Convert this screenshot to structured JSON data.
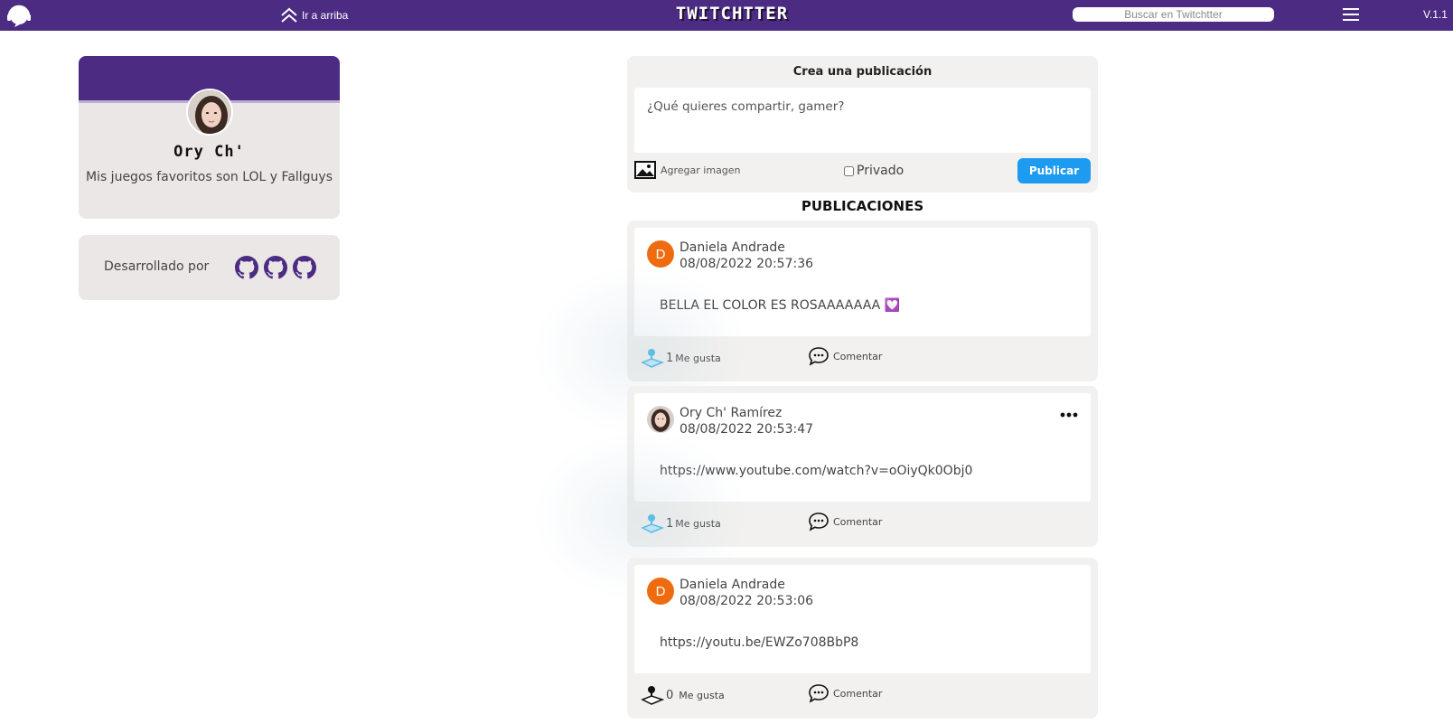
{
  "navbar": {
    "top_link_label": "Ir a arriba",
    "brand": "TWITCHTTER",
    "search_placeholder": "Buscar en Twitchtter",
    "version": "V.1.1"
  },
  "profile": {
    "name": "Ory Ch'",
    "bio": "Mis juegos favoritos son LOL y Fallguys"
  },
  "developers": {
    "label": "Desarrollado por",
    "icons": [
      "github-icon",
      "github-icon",
      "github-icon"
    ]
  },
  "composer": {
    "title": "Crea una publicación",
    "placeholder": "¿Qué quieres compartir, gamer?",
    "add_image_label": "Agregar imagen",
    "private_label": "Privado",
    "publish_label": "Publicar"
  },
  "posts_heading": "PUBLICACIONES",
  "posts": [
    {
      "author": "Daniela Andrade",
      "avatar_letter": "D",
      "date": "08/08/2022 20:57:36",
      "text": "BELLA EL COLOR ES ROSAAAAAAA 💟",
      "likes": "1",
      "liked": true,
      "like_label": "Me gusta",
      "comment_label": "Comentar"
    },
    {
      "author": "Ory Ch' Ramírez",
      "avatar_letter": "",
      "date": "08/08/2022 20:53:47",
      "text": "https://www.youtube.com/watch?v=oOiyQk0Obj0",
      "likes": "1",
      "liked": true,
      "like_label": "Me gusta",
      "comment_label": "Comentar"
    },
    {
      "author": "Daniela Andrade",
      "avatar_letter": "D",
      "date": "08/08/2022 20:53:06",
      "text": "https://youtu.be/EWZo708BbP8",
      "likes": "0",
      "liked": false,
      "like_label": "Me gusta",
      "comment_label": "Comentar"
    }
  ],
  "colors": {
    "brand_purple": "#4c2b83",
    "publish_blue": "#1d9bf0",
    "avatar_orange": "#ee6c0f",
    "like_active": "#3fb6e8"
  }
}
